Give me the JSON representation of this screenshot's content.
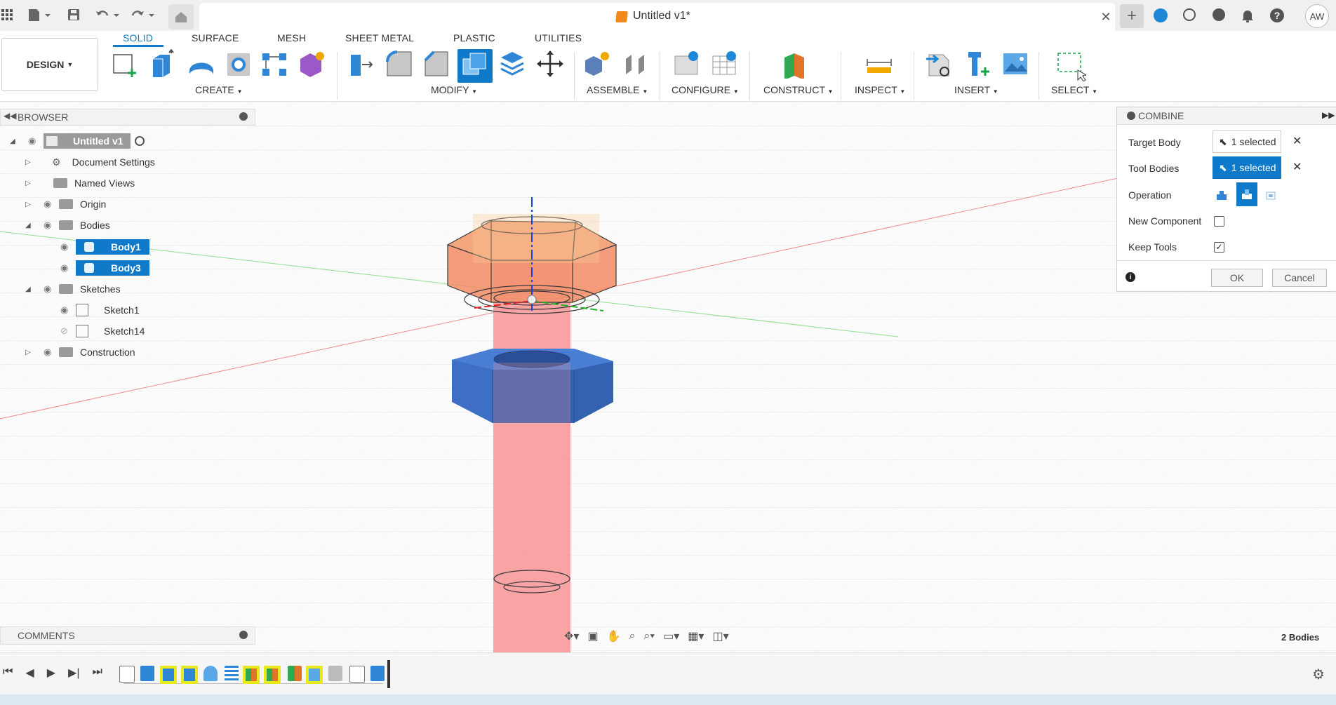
{
  "topbar": {
    "doc_title": "Untitled v1*",
    "avatar": "AW",
    "icons": [
      "grid-icon",
      "file-icon",
      "save-icon",
      "undo-icon",
      "redo-icon",
      "home-icon",
      "close-icon",
      "plus-icon",
      "extensions-icon",
      "online-icon",
      "history-icon",
      "bell-icon",
      "help-icon"
    ]
  },
  "ribbon": {
    "workspace": "DESIGN",
    "tabs": [
      "SOLID",
      "SURFACE",
      "MESH",
      "SHEET METAL",
      "PLASTIC",
      "UTILITIES"
    ],
    "active_tab": "SOLID",
    "groups": [
      "CREATE",
      "MODIFY",
      "ASSEMBLE",
      "CONFIGURE",
      "CONSTRUCT",
      "INSPECT",
      "INSERT",
      "SELECT"
    ]
  },
  "browser": {
    "title": "BROWSER",
    "root": "Untitled v1",
    "items": {
      "doc_settings": "Document Settings",
      "named_views": "Named Views",
      "origin": "Origin",
      "bodies": "Bodies",
      "body1": "Body1",
      "body3": "Body3",
      "sketches": "Sketches",
      "sketch1": "Sketch1",
      "sketch14": "Sketch14",
      "construction": "Construction"
    }
  },
  "combine": {
    "title": "COMBINE",
    "target_body_label": "Target Body",
    "target_body_value": "1 selected",
    "tool_bodies_label": "Tool Bodies",
    "tool_bodies_value": "1 selected",
    "operation_label": "Operation",
    "new_component_label": "New Component",
    "new_component_checked": false,
    "keep_tools_label": "Keep Tools",
    "keep_tools_checked": true,
    "ok": "OK",
    "cancel": "Cancel"
  },
  "comments": {
    "title": "COMMENTS"
  },
  "status": {
    "bodies": "2 Bodies"
  },
  "colors": {
    "accent": "#0e7ac9",
    "tool_body": "#f07a7a",
    "target_body": "#3d6fc4",
    "highlight": "#e8e81a"
  }
}
